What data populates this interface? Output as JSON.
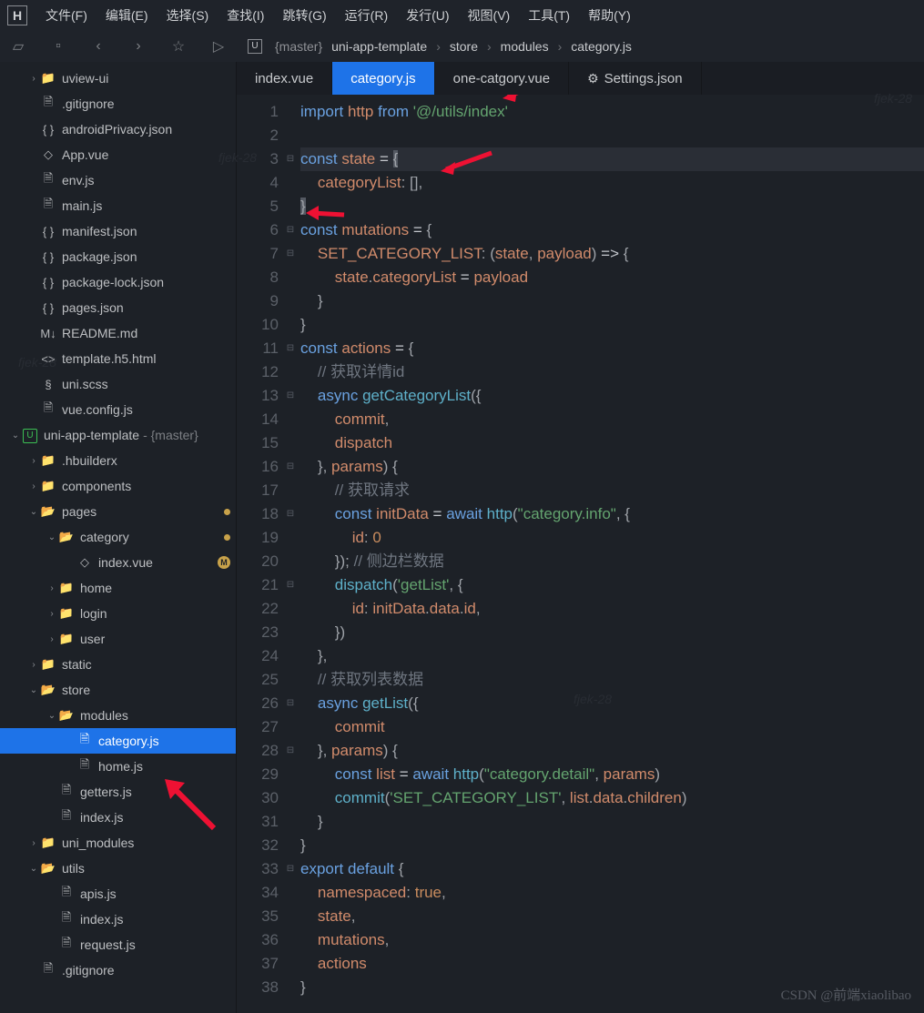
{
  "menubar": {
    "logo": "H",
    "items": [
      "文件(F)",
      "编辑(E)",
      "选择(S)",
      "查找(I)",
      "跳转(G)",
      "运行(R)",
      "发行(U)",
      "视图(V)",
      "工具(T)",
      "帮助(Y)"
    ]
  },
  "toolbar": {
    "icons": [
      "▭",
      "▭",
      "‹",
      "›",
      "☆",
      "▷"
    ]
  },
  "breadcrumb": {
    "branch": "{master}",
    "project": "uni-app-template",
    "segments": [
      "store",
      "modules",
      "category.js"
    ]
  },
  "tabs": [
    {
      "label": "index.vue",
      "active": false,
      "icon": ""
    },
    {
      "label": "category.js",
      "active": true,
      "icon": ""
    },
    {
      "label": "one-catgory.vue",
      "active": false,
      "icon": ""
    },
    {
      "label": "Settings.json",
      "active": false,
      "icon": "⚙"
    }
  ],
  "tree": [
    {
      "depth": 1,
      "chev": "›",
      "icon": "folder",
      "label": "uview-ui"
    },
    {
      "depth": 1,
      "chev": "",
      "icon": "file",
      "label": ".gitignore"
    },
    {
      "depth": 1,
      "chev": "",
      "icon": "json",
      "label": "androidPrivacy.json"
    },
    {
      "depth": 1,
      "chev": "",
      "icon": "vue",
      "label": "App.vue"
    },
    {
      "depth": 1,
      "chev": "",
      "icon": "js",
      "label": "env.js"
    },
    {
      "depth": 1,
      "chev": "",
      "icon": "js",
      "label": "main.js"
    },
    {
      "depth": 1,
      "chev": "",
      "icon": "json",
      "label": "manifest.json"
    },
    {
      "depth": 1,
      "chev": "",
      "icon": "json",
      "label": "package.json"
    },
    {
      "depth": 1,
      "chev": "",
      "icon": "json",
      "label": "package-lock.json"
    },
    {
      "depth": 1,
      "chev": "",
      "icon": "json",
      "label": "pages.json"
    },
    {
      "depth": 1,
      "chev": "",
      "icon": "md",
      "label": "README.md"
    },
    {
      "depth": 1,
      "chev": "",
      "icon": "html",
      "label": "template.h5.html"
    },
    {
      "depth": 1,
      "chev": "",
      "icon": "scss",
      "label": "uni.scss"
    },
    {
      "depth": 1,
      "chev": "",
      "icon": "js",
      "label": "vue.config.js"
    },
    {
      "depth": 0,
      "chev": "⌄",
      "icon": "proj",
      "label": "uni-app-template",
      "suffix": " - {master}"
    },
    {
      "depth": 1,
      "chev": "›",
      "icon": "folder",
      "label": ".hbuilderx"
    },
    {
      "depth": 1,
      "chev": "›",
      "icon": "folder",
      "label": "components"
    },
    {
      "depth": 1,
      "chev": "⌄",
      "icon": "folder-open",
      "label": "pages",
      "badge": "dot"
    },
    {
      "depth": 2,
      "chev": "⌄",
      "icon": "folder-open",
      "label": "category",
      "badge": "dot"
    },
    {
      "depth": 3,
      "chev": "",
      "icon": "vue",
      "label": "index.vue",
      "badge": "m"
    },
    {
      "depth": 2,
      "chev": "›",
      "icon": "folder",
      "label": "home"
    },
    {
      "depth": 2,
      "chev": "›",
      "icon": "folder",
      "label": "login"
    },
    {
      "depth": 2,
      "chev": "›",
      "icon": "folder",
      "label": "user"
    },
    {
      "depth": 1,
      "chev": "›",
      "icon": "folder",
      "label": "static"
    },
    {
      "depth": 1,
      "chev": "⌄",
      "icon": "folder-open",
      "label": "store"
    },
    {
      "depth": 2,
      "chev": "⌄",
      "icon": "folder-open",
      "label": "modules"
    },
    {
      "depth": 3,
      "chev": "",
      "icon": "js",
      "label": "category.js",
      "selected": true
    },
    {
      "depth": 3,
      "chev": "",
      "icon": "js",
      "label": "home.js"
    },
    {
      "depth": 2,
      "chev": "",
      "icon": "js",
      "label": "getters.js"
    },
    {
      "depth": 2,
      "chev": "",
      "icon": "js",
      "label": "index.js"
    },
    {
      "depth": 1,
      "chev": "›",
      "icon": "folder",
      "label": "uni_modules"
    },
    {
      "depth": 1,
      "chev": "⌄",
      "icon": "folder-open",
      "label": "utils"
    },
    {
      "depth": 2,
      "chev": "",
      "icon": "js",
      "label": "apis.js"
    },
    {
      "depth": 2,
      "chev": "",
      "icon": "js",
      "label": "index.js"
    },
    {
      "depth": 2,
      "chev": "",
      "icon": "js",
      "label": "request.js"
    },
    {
      "depth": 1,
      "chev": "",
      "icon": "file",
      "label": ".gitignore"
    }
  ],
  "icons": {
    "folder": "📁",
    "folder-open": "📂",
    "file": "🗎",
    "json": "{ }",
    "vue": "◇",
    "js": "🗎",
    "md": "M↓",
    "html": "<>",
    "scss": "§",
    "proj": "U"
  },
  "code": {
    "lines": [
      {
        "n": 1,
        "fold": "",
        "html": "<span class='kw'>import</span> <span class='id'>http</span> <span class='kw'>from</span> <span class='str'>'@/utils/index'</span>"
      },
      {
        "n": 2,
        "fold": "",
        "html": ""
      },
      {
        "n": 3,
        "fold": "⊟",
        "hl": true,
        "html": "<span class='kw'>const</span> <span class='id'>state</span> <span class='op'>=</span> <span class='brace bmatch'>{</span>"
      },
      {
        "n": 4,
        "fold": "",
        "html": "    <span class='prop'>categoryList</span><span class='pun'>:</span> <span class='pun'>[]</span><span class='pun'>,</span>"
      },
      {
        "n": 5,
        "fold": "",
        "html": "<span class='brace bmatch'>}</span>"
      },
      {
        "n": 6,
        "fold": "⊟",
        "html": "<span class='kw'>const</span> <span class='id'>mutations</span> <span class='op'>=</span> <span class='brace'>{</span>"
      },
      {
        "n": 7,
        "fold": "⊟",
        "html": "    <span class='prop'>SET_CATEGORY_LIST</span><span class='pun'>:</span> <span class='pun'>(</span><span class='id'>state</span><span class='pun'>,</span> <span class='id'>payload</span><span class='pun'>)</span> <span class='op'>=&gt;</span> <span class='brace'>{</span>"
      },
      {
        "n": 8,
        "fold": "",
        "html": "        <span class='id'>state</span><span class='pun'>.</span><span class='prop'>categoryList</span> <span class='op'>=</span> <span class='id'>payload</span>"
      },
      {
        "n": 9,
        "fold": "",
        "html": "    <span class='brace'>}</span>"
      },
      {
        "n": 10,
        "fold": "",
        "html": "<span class='brace'>}</span>"
      },
      {
        "n": 11,
        "fold": "⊟",
        "html": "<span class='kw'>const</span> <span class='id'>actions</span> <span class='op'>=</span> <span class='brace'>{</span>"
      },
      {
        "n": 12,
        "fold": "",
        "html": "    <span class='cmt'>// 获取详情id</span>"
      },
      {
        "n": 13,
        "fold": "⊟",
        "html": "    <span class='kw'>async</span> <span class='meth'>getCategoryList</span><span class='pun'>({</span>"
      },
      {
        "n": 14,
        "fold": "",
        "html": "        <span class='id'>commit</span><span class='pun'>,</span>"
      },
      {
        "n": 15,
        "fold": "",
        "html": "        <span class='id'>dispatch</span>"
      },
      {
        "n": 16,
        "fold": "⊟",
        "html": "    <span class='pun'>},</span> <span class='id'>params</span><span class='pun'>)</span> <span class='brace'>{</span>"
      },
      {
        "n": 17,
        "fold": "",
        "html": "        <span class='cmt'>// 获取请求</span>"
      },
      {
        "n": 18,
        "fold": "⊟",
        "html": "        <span class='kw'>const</span> <span class='id'>initData</span> <span class='op'>=</span> <span class='kw'>await</span> <span class='meth'>http</span><span class='pun'>(</span><span class='str'>\"category.info\"</span><span class='pun'>,</span> <span class='brace'>{</span>"
      },
      {
        "n": 19,
        "fold": "",
        "html": "            <span class='prop'>id</span><span class='pun'>:</span> <span class='num'>0</span>"
      },
      {
        "n": 20,
        "fold": "",
        "html": "        <span class='brace'>}</span><span class='pun'>);</span> <span class='cmt'>// 侧边栏数据</span>"
      },
      {
        "n": 21,
        "fold": "⊟",
        "html": "        <span class='meth'>dispatch</span><span class='pun'>(</span><span class='str'>'getList'</span><span class='pun'>,</span> <span class='brace'>{</span>"
      },
      {
        "n": 22,
        "fold": "",
        "html": "            <span class='prop'>id</span><span class='pun'>:</span> <span class='id'>initData</span><span class='pun'>.</span><span class='prop'>data</span><span class='pun'>.</span><span class='prop'>id</span><span class='pun'>,</span>"
      },
      {
        "n": 23,
        "fold": "",
        "html": "        <span class='brace'>}</span><span class='pun'>)</span>"
      },
      {
        "n": 24,
        "fold": "",
        "html": "    <span class='brace'>}</span><span class='pun'>,</span>"
      },
      {
        "n": 25,
        "fold": "",
        "html": "    <span class='cmt'>// 获取列表数据</span>"
      },
      {
        "n": 26,
        "fold": "⊟",
        "html": "    <span class='kw'>async</span> <span class='meth'>getList</span><span class='pun'>({</span>"
      },
      {
        "n": 27,
        "fold": "",
        "html": "        <span class='id'>commit</span>"
      },
      {
        "n": 28,
        "fold": "⊟",
        "html": "    <span class='pun'>},</span> <span class='id'>params</span><span class='pun'>)</span> <span class='brace'>{</span>"
      },
      {
        "n": 29,
        "fold": "",
        "html": "        <span class='kw'>const</span> <span class='id'>list</span> <span class='op'>=</span> <span class='kw'>await</span> <span class='meth'>http</span><span class='pun'>(</span><span class='str'>\"category.detail\"</span><span class='pun'>,</span> <span class='id'>params</span><span class='pun'>)</span>"
      },
      {
        "n": 30,
        "fold": "",
        "html": "        <span class='meth'>commit</span><span class='pun'>(</span><span class='str'>'SET_CATEGORY_LIST'</span><span class='pun'>,</span> <span class='id'>list</span><span class='pun'>.</span><span class='prop'>data</span><span class='pun'>.</span><span class='prop'>children</span><span class='pun'>)</span>"
      },
      {
        "n": 31,
        "fold": "",
        "html": "    <span class='brace'>}</span>"
      },
      {
        "n": 32,
        "fold": "",
        "html": "<span class='brace'>}</span>"
      },
      {
        "n": 33,
        "fold": "⊟",
        "html": "<span class='kw'>export</span> <span class='kw'>default</span> <span class='brace'>{</span>"
      },
      {
        "n": 34,
        "fold": "",
        "html": "    <span class='prop'>namespaced</span><span class='pun'>:</span> <span class='lit'>true</span><span class='pun'>,</span>"
      },
      {
        "n": 35,
        "fold": "",
        "html": "    <span class='id'>state</span><span class='pun'>,</span>"
      },
      {
        "n": 36,
        "fold": "",
        "html": "    <span class='id'>mutations</span><span class='pun'>,</span>"
      },
      {
        "n": 37,
        "fold": "",
        "html": "    <span class='id'>actions</span>"
      },
      {
        "n": 38,
        "fold": "",
        "html": "<span class='brace'>}</span>"
      }
    ]
  },
  "watermark": "CSDN @前端xiaolibao",
  "ghost": "fjek-28"
}
